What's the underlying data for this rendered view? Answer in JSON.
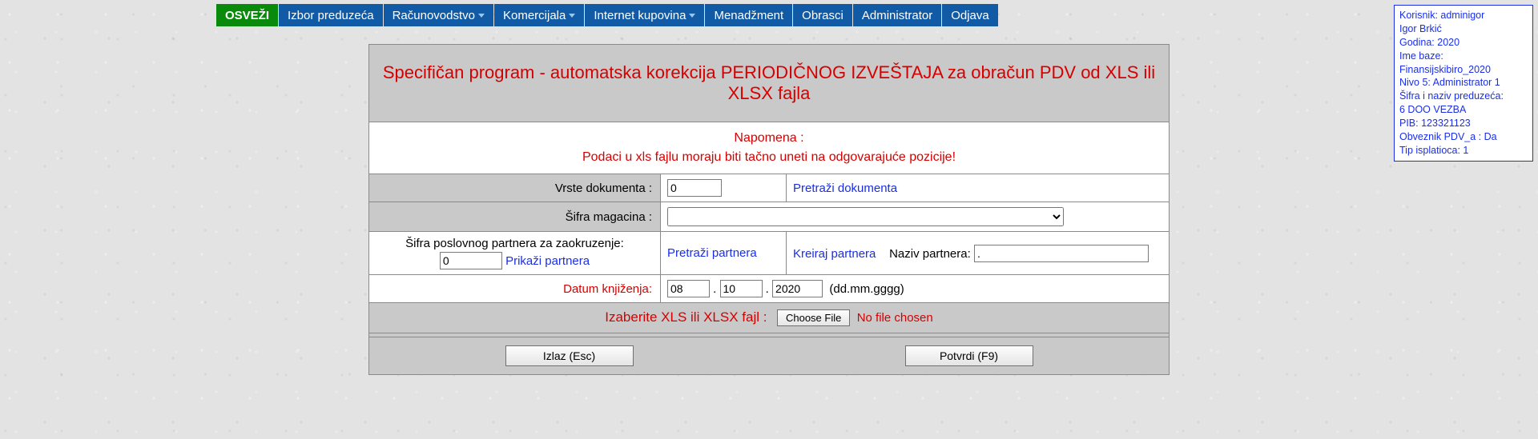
{
  "nav": {
    "refresh": "OSVEŽI",
    "items": [
      "Izbor preduzeća",
      "Računovodstvo",
      "Komercijala",
      "Internet kupovina",
      "Menadžment",
      "Obrasci",
      "Administrator",
      "Odjava"
    ],
    "dropdown_flags": [
      false,
      true,
      true,
      true,
      false,
      false,
      false,
      false
    ]
  },
  "infobox": {
    "l1": "Korisnik: adminigor",
    "l2": "Igor Brkić",
    "l3": "Godina: 2020",
    "l4": "Ime baze:",
    "l5": "Finansijskibiro_2020",
    "l6": "Nivo 5: Administrator 1",
    "l7": "Šifra i naziv preduzeća:",
    "l8": "6 DOO VEZBA",
    "l9": "PIB: 123321123",
    "l10": "Obveznik PDV_a : Da",
    "l11": "Tip isplatioca: 1"
  },
  "header": "Specifičan program - automatska korekcija PERIODIČNOG IZVEŠTAJA za obračun PDV od XLS ili XLSX fajla",
  "note": {
    "line1": "Napomena :",
    "line2": "Podaci u xls fajlu moraju biti tačno uneti na odgovarajuće pozicije!"
  },
  "row_doc": {
    "label": "Vrste dokumenta :",
    "value": "0",
    "search": "Pretraži dokumenta"
  },
  "row_mag": {
    "label": "Šifra magacina :",
    "value": ""
  },
  "row_partner": {
    "label": "Šifra poslovnog partnera za zaokruzenje:",
    "value": "0",
    "show": "Prikaži partnera",
    "search": "Pretraži partnera",
    "create": "Kreiraj partnera",
    "name_label": "Naziv partnera:",
    "name_value": "."
  },
  "row_date": {
    "label": "Datum knjiženja:",
    "dd": "08",
    "mm": "10",
    "yyyy": "2020",
    "hint": "(dd.mm.gggg)"
  },
  "row_file": {
    "label": "Izaberite XLS ili XLSX fajl :",
    "button": "Choose File",
    "status": "No file chosen"
  },
  "buttons": {
    "exit": "Izlaz (Esc)",
    "confirm": "Potvrdi (F9)"
  }
}
